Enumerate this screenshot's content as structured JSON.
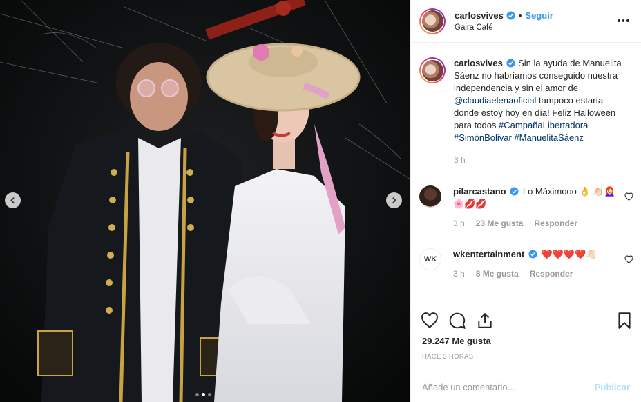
{
  "post": {
    "username": "carlosvives",
    "separator": "•",
    "follow_label": "Seguir",
    "location": "Gaira Café"
  },
  "caption": {
    "username": "carlosvives",
    "text_before": "Sin la ayuda de Manuelita Sáenz no habríamos conseguido nuestra independencia y sin el amor de ",
    "mention": "@claudiaelenaoficial",
    "text_after": " tampoco estaría donde estoy hoy en día! Feliz Halloween para todos ",
    "hashtags": [
      "#CampañaLibertadora",
      "#SimónBolivar",
      "#ManuelitaSáenz"
    ],
    "time": "3 h"
  },
  "comments": [
    {
      "username": "pilarcastano",
      "text": "Lo Màximooo 👌 👏🏻👩🏻‍🦰🌸💋💋",
      "time": "3 h",
      "likes": "23 Me gusta",
      "reply": "Responder"
    },
    {
      "username": "wkentertainment",
      "avatar_text": "WK",
      "text": "❤️❤️❤️❤️👋🏻",
      "time": "3 h",
      "likes": "8 Me gusta",
      "reply": "Responder"
    }
  ],
  "stats": {
    "likes": "29.247 Me gusta",
    "posted": "HACE 3 HORAS"
  },
  "composer": {
    "placeholder": "Añade un comentario...",
    "publish": "Publicar"
  },
  "carousel": {
    "slides": 3,
    "current": 2
  },
  "colors": {
    "accent": "#3897f0",
    "text": "#262626",
    "muted": "#999999",
    "mention": "#003569"
  }
}
